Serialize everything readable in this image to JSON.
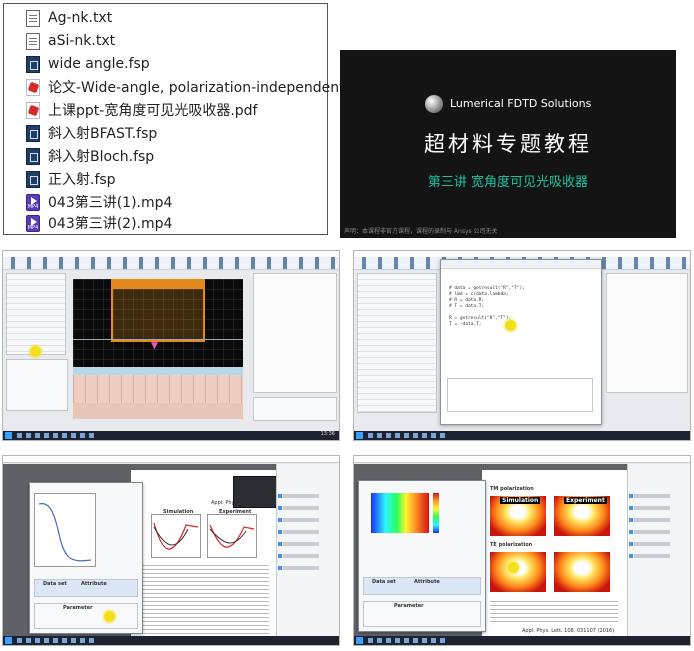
{
  "files": [
    {
      "name": "Ag-nk.txt",
      "icon": "text-file-icon"
    },
    {
      "name": "aSi-nk.txt",
      "icon": "text-file-icon"
    },
    {
      "name": "wide angle.fsp",
      "icon": "fsp-file-icon"
    },
    {
      "name": "论文-Wide-angle, polarization-independent",
      "icon": "pdf-file-icon"
    },
    {
      "name": "上课ppt-宽角度可见光吸收器.pdf",
      "icon": "pdf-file-icon"
    },
    {
      "name": "斜入射BFAST.fsp",
      "icon": "fsp-file-icon"
    },
    {
      "name": "斜入射Bloch.fsp",
      "icon": "fsp-file-icon"
    },
    {
      "name": "正入射.fsp",
      "icon": "fsp-file-icon"
    },
    {
      "name": "043第三讲(1).mp4",
      "icon": "mp4-file-icon"
    },
    {
      "name": "043第三讲(2).mp4",
      "icon": "mp4-file-icon"
    }
  ],
  "slide": {
    "brand": "Lumerical FDTD Solutions",
    "title": "超材料专题教程",
    "subtitle": "第三讲  宽角度可见光吸收器",
    "footnote": "声明：本课程非官方课程，课程的录制与 Ansys 公司无关",
    "accent_color": "#1bc2a2"
  },
  "screens": {
    "cad": {
      "clock": "13:36"
    },
    "script": {
      "code": "# data = getresult(\"R\",\"T\");\n# lmd = c/data.lambda;\n# R = data.R;\n# T = data.T;\n\nR = getresult(\"R\",\"T\");\nT = -data.T;"
    },
    "paper": {
      "journal": "Appl. Phys. Lett. 108, 031107 (2016)",
      "sim_label": "Simulation",
      "exp_label": "Experiment",
      "col_data_set": "Data set",
      "col_attribute": "Attribute",
      "col_parameter": "Parameter"
    },
    "heatmap": {
      "tm_label": "TM polarization",
      "te_label": "TE polarization",
      "sim_label": "Simulation",
      "exp_label": "Experiment",
      "col_data_set": "Data set",
      "col_attribute": "Attribute",
      "col_parameter": "Parameter",
      "journal": "Appl. Phys. Lett. 108, 031107 (2016)"
    }
  }
}
